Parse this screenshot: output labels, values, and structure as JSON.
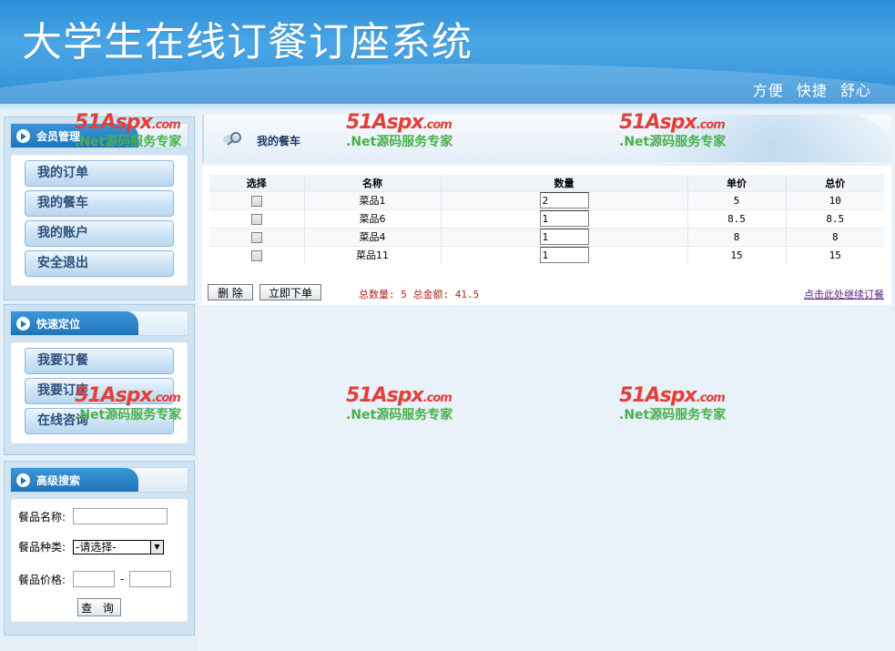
{
  "header": {
    "title": "大学生在线订餐订座系统",
    "slogan": [
      "方便",
      "快捷",
      "舒心"
    ]
  },
  "sidebar": {
    "member": {
      "title": "会员管理",
      "items": [
        "我的订单",
        "我的餐车",
        "我的账户",
        "安全退出"
      ]
    },
    "quick": {
      "title": "快速定位",
      "items": [
        "我要订餐",
        "我要订座",
        "在线咨询"
      ]
    },
    "search": {
      "title": "高级搜索",
      "name_label": "餐品名称:",
      "type_label": "餐品种类:",
      "type_value": "-请选择-",
      "price_label": "餐品价格:",
      "price_sep": "-",
      "query_button": "查 询"
    }
  },
  "main": {
    "title": "我的餐车",
    "table": {
      "headers": [
        "选择",
        "名称",
        "数量",
        "单价",
        "总价"
      ],
      "rows": [
        {
          "name": "菜品1",
          "qty": "2",
          "price": "5",
          "total": "10"
        },
        {
          "name": "菜品6",
          "qty": "1",
          "price": "8.5",
          "total": "8.5"
        },
        {
          "name": "菜品4",
          "qty": "1",
          "price": "8",
          "total": "8"
        },
        {
          "name": "菜品11",
          "qty": "1",
          "price": "15",
          "total": "15"
        }
      ]
    },
    "delete_button": "删 除",
    "order_button": "立即下单",
    "summary": "总数量: 5 总金额: 41.5",
    "continue_link": "点击此处继续订餐"
  },
  "watermark": {
    "logo": "51Aspx",
    "domain": ".com",
    "text": ".Net源码服务专家"
  },
  "colors": {
    "header_blue": "#2c8fd6",
    "summary_red": "#b2271d",
    "link_purple": "#5a1e7c",
    "watermark_red": "#e2403a",
    "watermark_green": "#48b04a"
  }
}
